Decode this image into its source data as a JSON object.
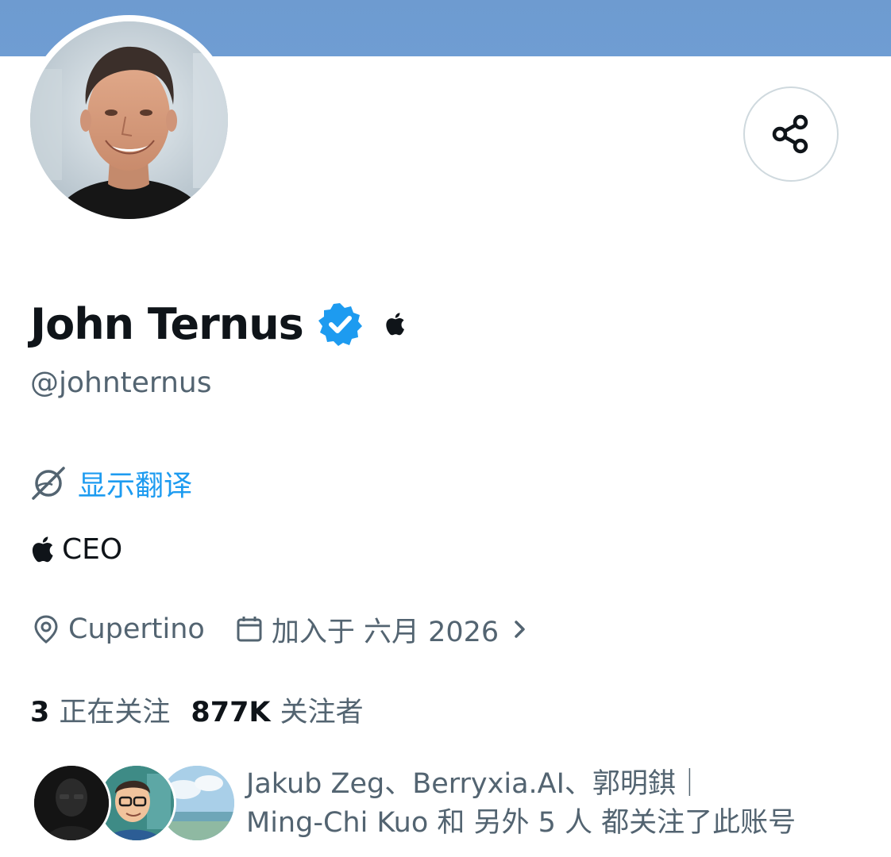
{
  "profile": {
    "display_name": "John Ternus",
    "handle": "@johnternus",
    "translate_label": "显示翻译",
    "bio": "CEO",
    "location": "Cupertino",
    "joined": "加入于 六月 2026",
    "following_count": "3",
    "following_label": "正在关注",
    "followers_count": "877K",
    "followers_label": "关注者"
  },
  "followed_by": {
    "line1": "Jakub Zeg、Berryxia.AI、郭明錤｜",
    "line2": "Ming-Chi Kuo 和 另外 5 人 都关注了此账号"
  },
  "colors": {
    "banner": "#6f9dd3",
    "verified_badge": "#1d9bf0",
    "link": "#1d9bf0",
    "primary_text": "#0f1419",
    "secondary_text": "#536471"
  },
  "icons": {
    "share": "share-icon",
    "verified": "verified-badge-icon",
    "affiliation": "apple-logo-icon",
    "translate": "translate-icon",
    "location": "location-pin-icon",
    "calendar": "calendar-icon",
    "chevron": "chevron-right-icon"
  }
}
